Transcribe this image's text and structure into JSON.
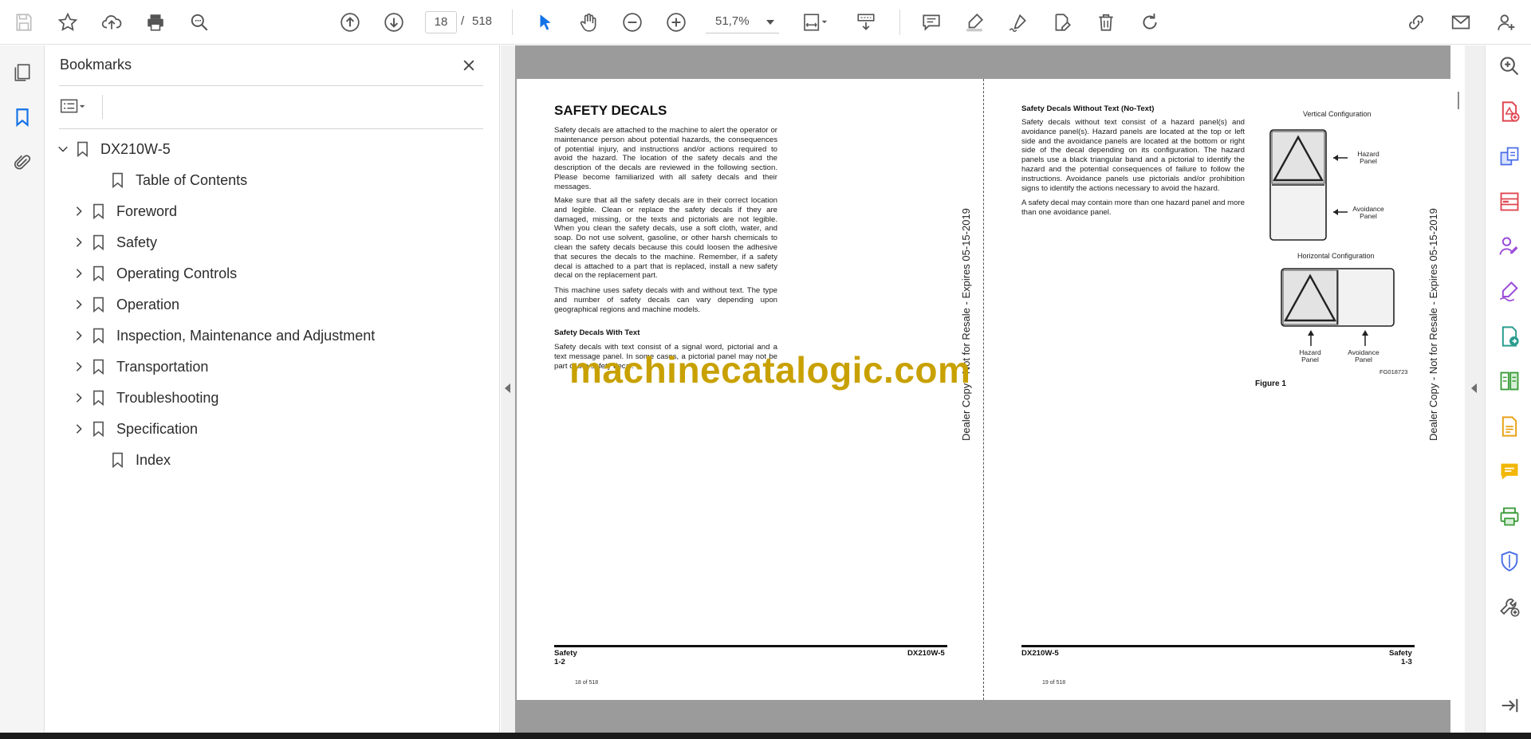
{
  "toolbar": {
    "page_current": "18",
    "page_separator": "/",
    "page_total": "518",
    "zoom": "51,7%"
  },
  "bookmarks": {
    "title": "Bookmarks",
    "items": [
      {
        "label": "DX210W-5",
        "expanded": true
      },
      {
        "label": "Table of Contents"
      },
      {
        "label": "Foreword"
      },
      {
        "label": "Safety"
      },
      {
        "label": "Operating Controls"
      },
      {
        "label": "Operation"
      },
      {
        "label": "Inspection, Maintenance and Adjustment"
      },
      {
        "label": "Transportation"
      },
      {
        "label": "Troubleshooting"
      },
      {
        "label": "Specification"
      },
      {
        "label": "Index"
      }
    ]
  },
  "document": {
    "left_page": {
      "heading": "SAFETY DECALS",
      "para1": "Safety decals are attached to the machine to alert the operator or maintenance person about potential hazards, the consequences of potential injury, and instructions and/or actions required to avoid the hazard. The location of the safety decals and the description of the decals are reviewed in the following section. Please become familiarized with all safety decals and their messages.",
      "para2": "Make sure that all the safety decals are in their correct location and legible. Clean or replace the safety decals if they are damaged, missing, or the texts and pictorials are not legible. When you clean the safety decals, use a soft cloth, water, and soap. Do not use solvent, gasoline, or other harsh chemicals to clean the safety decals because this could loosen the adhesive that secures the decals to the machine. Remember, if a safety decal is attached to a part that is replaced, install a new safety decal on the replacement part.",
      "para3": "This machine uses safety decals with and without text. The type and number of safety decals can vary depending upon geographical regions and machine models.",
      "subheading": "Safety Decals With Text",
      "para4": "Safety decals with text consist of a signal word, pictorial and a text message panel. In some cases, a pictorial panel may not be part of the safety decal.",
      "footer_left": "Safety",
      "footer_left_num": "1-2",
      "footer_right": "DX210W-5",
      "page_of": "18 of 518",
      "watermark": "Dealer Copy - Not for Resale - Expires 05-15-2019"
    },
    "right_page": {
      "subheading": "Safety Decals Without Text (No-Text)",
      "para1": "Safety decals without text consist of a hazard panel(s) and avoidance panel(s). Hazard panels are located at the top or left side and the avoidance panels are located at the bottom or right side of the decal depending on its configuration. The hazard panels use a black triangular band and a pictorial to identify the hazard and the potential consequences of failure to follow the instructions. Avoidance panels use pictorials and/or prohibition signs to identify the actions necessary to avoid the hazard.",
      "para2": "A safety decal may contain more than one hazard panel and more than one avoidance panel.",
      "figure": {
        "vertical_title": "Vertical Configuration",
        "horizontal_title": "Horizontal Configuration",
        "hazard_panel": "Hazard Panel",
        "avoidance_panel": "Avoidance Panel",
        "figure_id": "FG018723",
        "caption": "Figure 1"
      },
      "footer_left": "DX210W-5",
      "footer_right": "Safety",
      "footer_right_num": "1-3",
      "page_of": "19 of 518",
      "watermark": "Dealer Copy - Not for Resale - Expires 05-15-2019"
    },
    "overlay_brand": "machinecatalogic.com"
  },
  "colors": {
    "accent": "#1473e6",
    "brand_overlay": "#c8a100",
    "right_rail_red": "#e0454f",
    "right_rail_purple": "#9b4cd8"
  }
}
